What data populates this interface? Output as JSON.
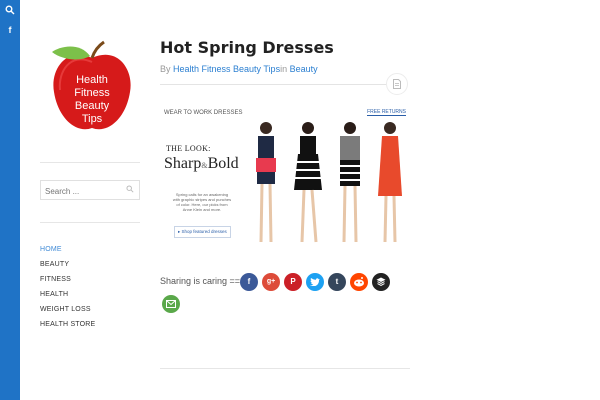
{
  "sidebar_rail": {
    "color": "#1f73c6",
    "icons": [
      "search-icon",
      "facebook-icon"
    ]
  },
  "logo": {
    "line1": "Health",
    "line2": "Fitness",
    "line3": "Beauty",
    "line4": "Tips"
  },
  "search": {
    "placeholder": "Search ..."
  },
  "nav": {
    "items": [
      {
        "label": "HOME"
      },
      {
        "label": "BEAUTY"
      },
      {
        "label": "FITNESS"
      },
      {
        "label": "HEALTH"
      },
      {
        "label": "WEIGHT LOSS"
      },
      {
        "label": "HEALTH STORE"
      }
    ]
  },
  "post": {
    "title": "Hot Spring Dresses",
    "by_prefix": "By ",
    "author": "Health Fitness Beauty Tips",
    "in_prefix": "in ",
    "category": "Beauty"
  },
  "banner": {
    "heading": "WEAR TO WORK DRESSES",
    "free_returns": "FREE RETURNS",
    "the_look": "THE LOOK:",
    "sharp": "Sharp",
    "amp": "&",
    "bold": "Bold",
    "copy": "Spring calls for an awakening with graphic stripes and punches of color. Here, our picks from Anne Klein and more.",
    "cta": "Shop featured dresses"
  },
  "sharing": {
    "label": "Sharing is caring ==>",
    "buttons": [
      {
        "icon": "facebook-icon",
        "color": "#3b5998"
      },
      {
        "icon": "google-plus-icon",
        "color": "#dd4b39"
      },
      {
        "icon": "pinterest-icon",
        "color": "#cb2027"
      },
      {
        "icon": "twitter-icon",
        "color": "#1da1f2"
      },
      {
        "icon": "tumblr-icon",
        "color": "#35465c"
      },
      {
        "icon": "reddit-icon",
        "color": "#ff4500"
      },
      {
        "icon": "buffer-icon",
        "color": "#222222"
      },
      {
        "icon": "email-icon",
        "color": "#5aa84a"
      }
    ]
  }
}
